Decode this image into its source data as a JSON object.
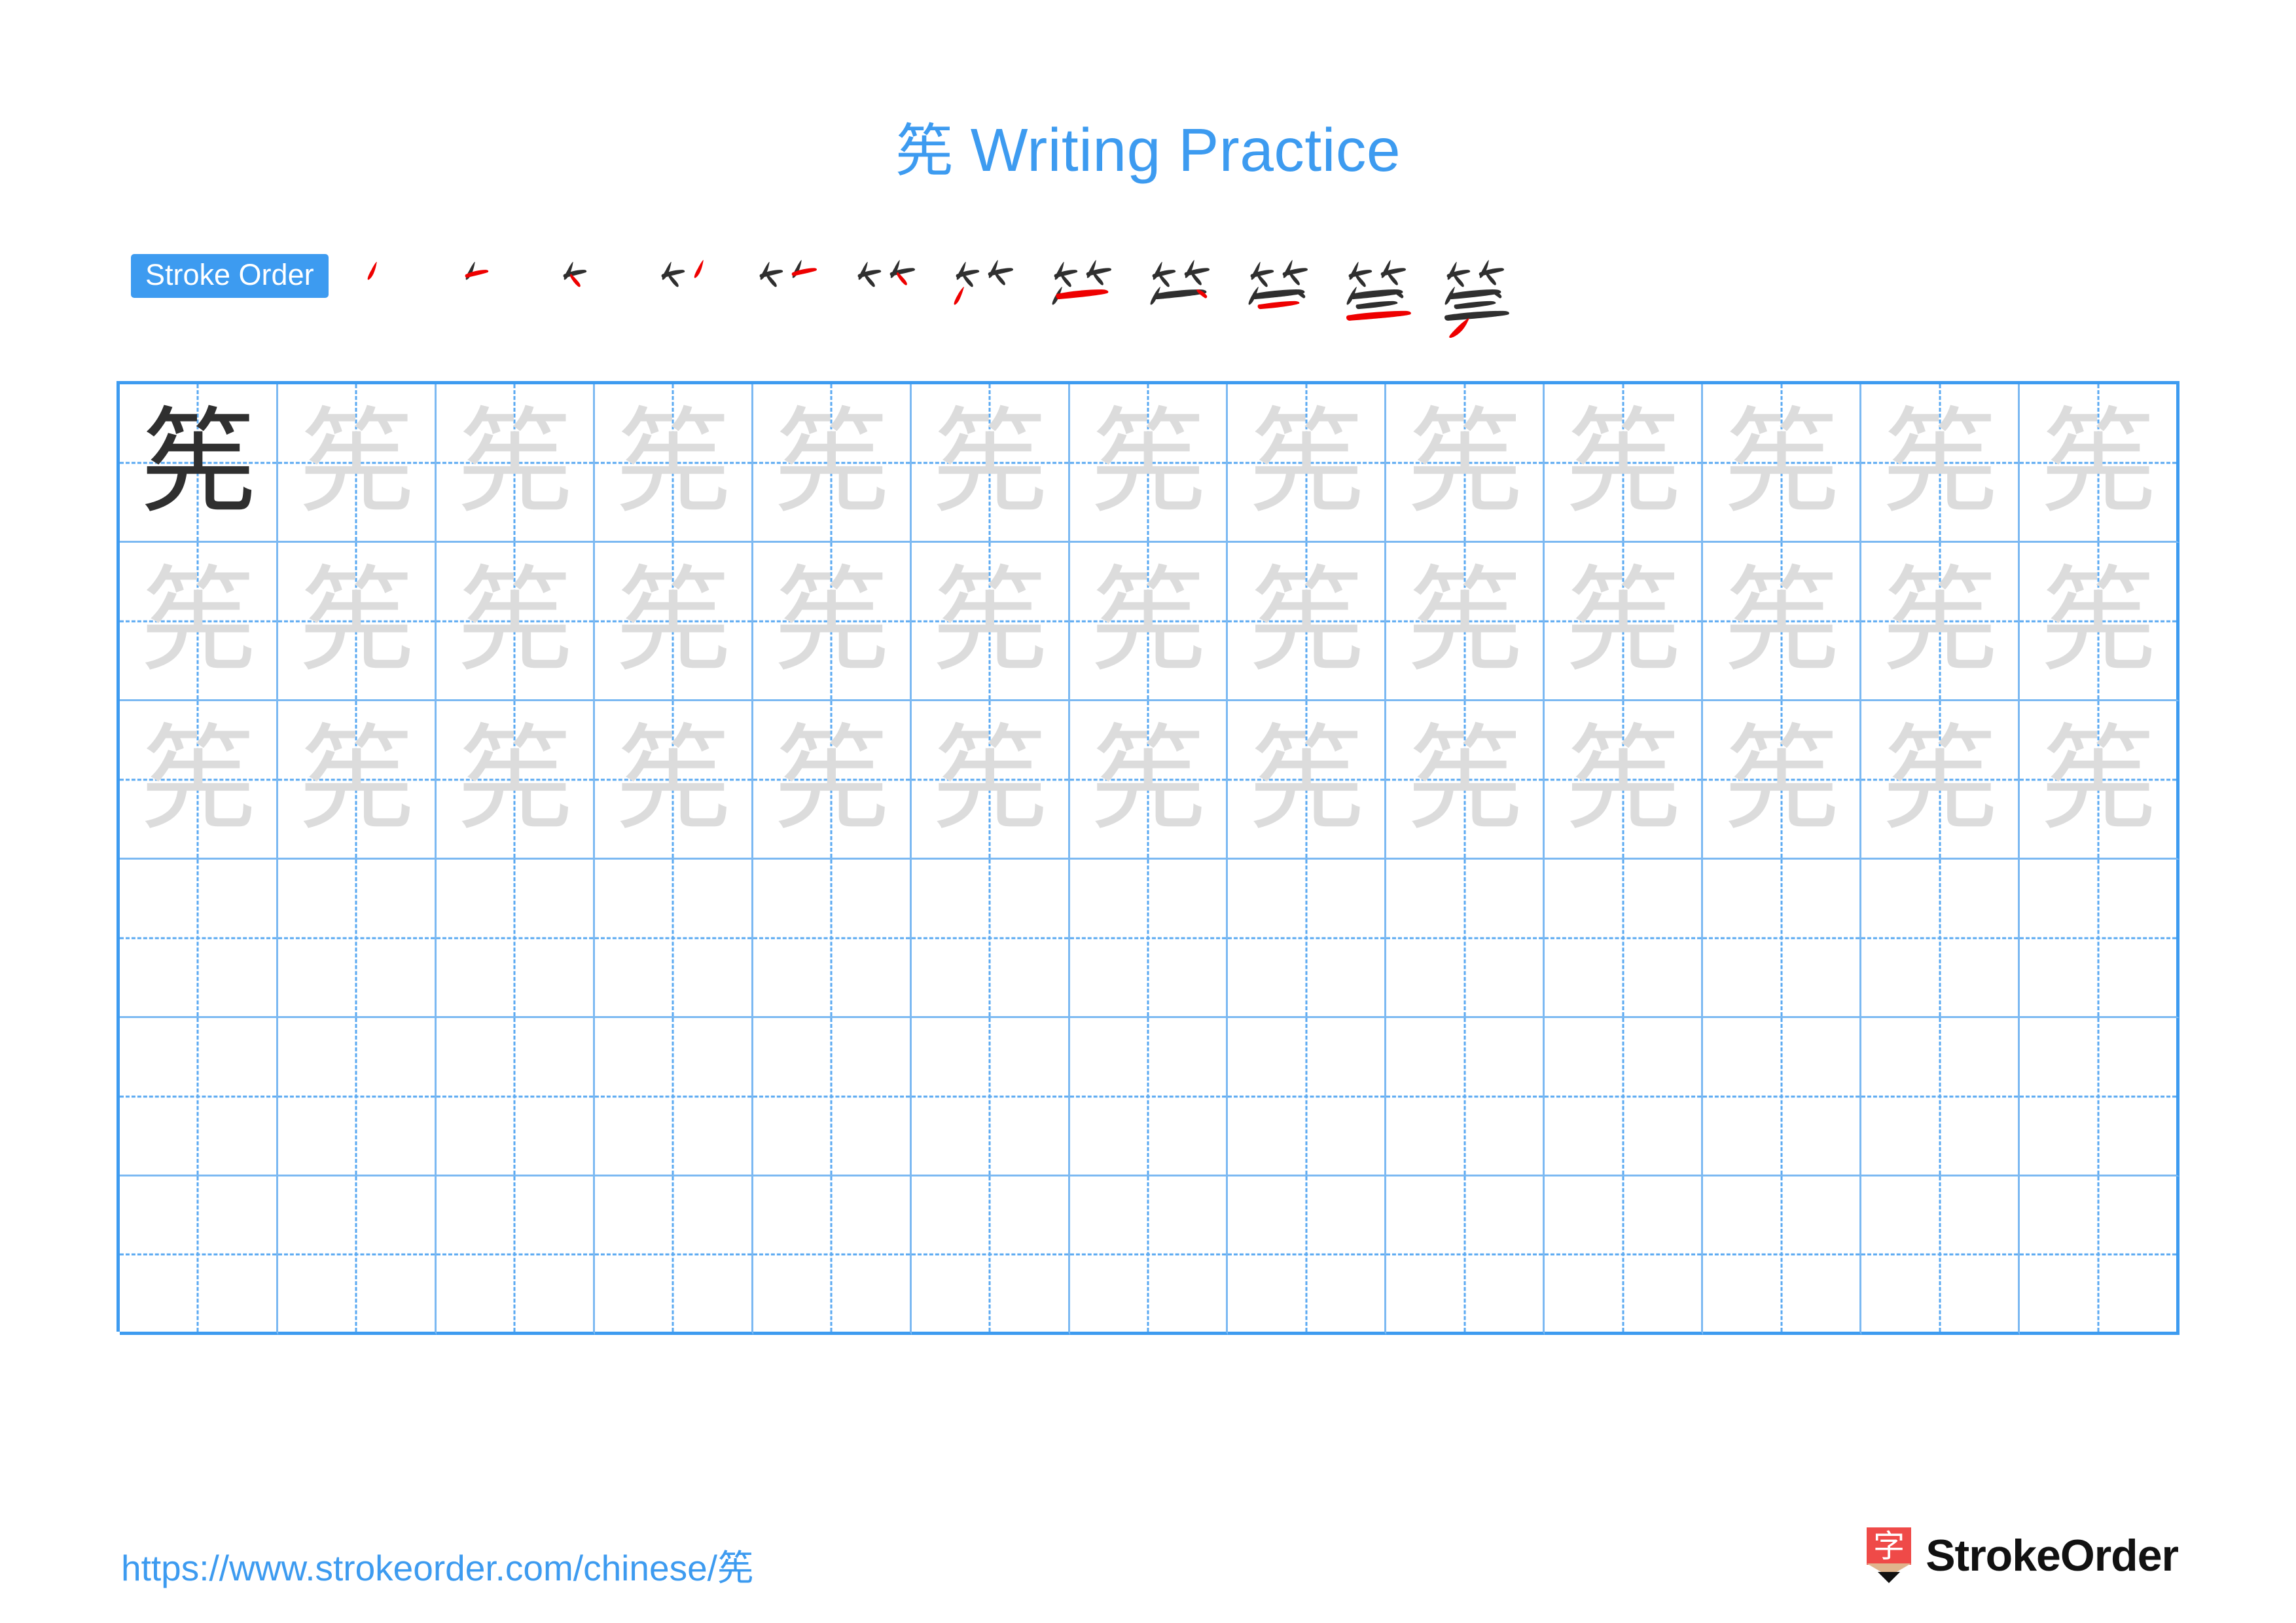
{
  "header": {
    "character": "筅",
    "title_suffix": " Writing Practice"
  },
  "stroke_order": {
    "label": "Stroke Order",
    "total_strokes": 12,
    "steps": [
      {
        "index": 1,
        "cumulative": "丿"
      },
      {
        "index": 2,
        "cumulative": "𠂉"
      },
      {
        "index": 3,
        "cumulative": "⺮部分"
      },
      {
        "index": 4,
        "cumulative": "⺮部分"
      },
      {
        "index": 5,
        "cumulative": "⺮部分"
      },
      {
        "index": 6,
        "cumulative": "⺮"
      },
      {
        "index": 7,
        "cumulative": "⺮丿"
      },
      {
        "index": 8,
        "cumulative": "笁"
      },
      {
        "index": 9,
        "cumulative": "笁"
      },
      {
        "index": 10,
        "cumulative": "竺"
      },
      {
        "index": 11,
        "cumulative": "笒"
      },
      {
        "index": 12,
        "cumulative": "筅"
      }
    ]
  },
  "practice_grid": {
    "columns": 13,
    "rows": 6,
    "character": "筅",
    "rows_data": [
      {
        "row": 1,
        "cells": [
          "dark",
          "light",
          "light",
          "light",
          "light",
          "light",
          "light",
          "light",
          "light",
          "light",
          "light",
          "light",
          "light"
        ]
      },
      {
        "row": 2,
        "cells": [
          "light",
          "light",
          "light",
          "light",
          "light",
          "light",
          "light",
          "light",
          "light",
          "light",
          "light",
          "light",
          "light"
        ]
      },
      {
        "row": 3,
        "cells": [
          "light",
          "light",
          "light",
          "light",
          "light",
          "light",
          "light",
          "light",
          "light",
          "light",
          "light",
          "light",
          "light"
        ]
      },
      {
        "row": 4,
        "cells": [
          "empty",
          "empty",
          "empty",
          "empty",
          "empty",
          "empty",
          "empty",
          "empty",
          "empty",
          "empty",
          "empty",
          "empty",
          "empty"
        ]
      },
      {
        "row": 5,
        "cells": [
          "empty",
          "empty",
          "empty",
          "empty",
          "empty",
          "empty",
          "empty",
          "empty",
          "empty",
          "empty",
          "empty",
          "empty",
          "empty"
        ]
      },
      {
        "row": 6,
        "cells": [
          "empty",
          "empty",
          "empty",
          "empty",
          "empty",
          "empty",
          "empty",
          "empty",
          "empty",
          "empty",
          "empty",
          "empty",
          "empty"
        ]
      }
    ]
  },
  "footer": {
    "url": "https://www.strokeorder.com/chinese/筅",
    "brand_name": "StrokeOrder",
    "brand_glyph": "字"
  },
  "colors": {
    "accent_blue": "#3d9bf0",
    "grid_line_light": "#7cb9f2",
    "guide_dash": "#5aa9f2",
    "stroke_dark": "#2f2f2f",
    "stroke_new_red": "#ee0000",
    "ghost_char": "#dcdcdc",
    "brand_red": "#ef4a48",
    "brand_wood": "#e0b48c"
  }
}
